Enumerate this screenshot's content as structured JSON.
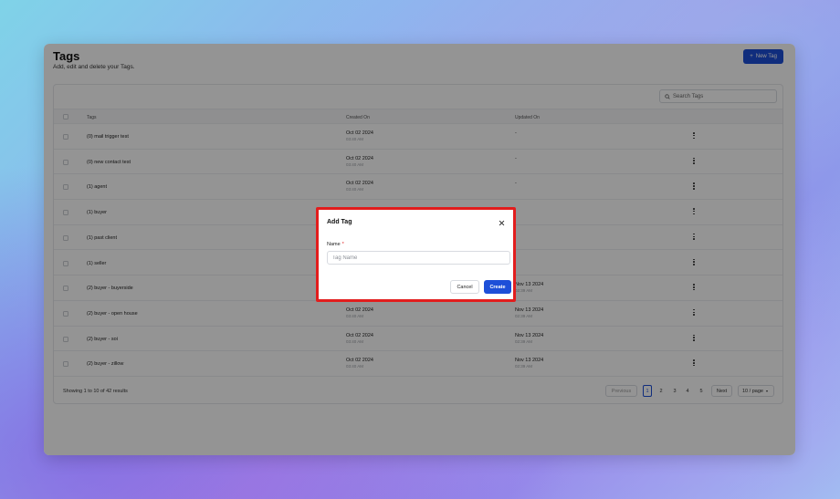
{
  "page": {
    "title": "Tags",
    "subtitle": "Add, edit and delete your Tags.",
    "new_tag_label": "New Tag"
  },
  "search": {
    "placeholder": "Search Tags"
  },
  "table": {
    "columns": [
      "Tags",
      "Created On",
      "Updated On"
    ],
    "rows": [
      {
        "name": "(0) mail trigger test",
        "created_date": "Oct 02 2024",
        "created_time": "03:40 AM",
        "updated_date": "-",
        "updated_time": ""
      },
      {
        "name": "(0) new contact test",
        "created_date": "Oct 02 2024",
        "created_time": "03:40 AM",
        "updated_date": "-",
        "updated_time": ""
      },
      {
        "name": "(1) agent",
        "created_date": "Oct 02 2024",
        "created_time": "03:40 AM",
        "updated_date": "-",
        "updated_time": ""
      },
      {
        "name": "(1) buyer",
        "created_date": "",
        "created_time": "",
        "updated_date": "",
        "updated_time": ""
      },
      {
        "name": "(1) past client",
        "created_date": "",
        "created_time": "",
        "updated_date": "",
        "updated_time": ""
      },
      {
        "name": "(1) seller",
        "created_date": "",
        "created_time": "",
        "updated_date": "",
        "updated_time": ""
      },
      {
        "name": "(2) buyer - buyerside",
        "created_date": "",
        "created_time": "",
        "updated_date": "Nov 13 2024",
        "updated_time": "02:39 AM"
      },
      {
        "name": "(2) buyer - open house",
        "created_date": "Oct 02 2024",
        "created_time": "03:40 AM",
        "updated_date": "Nov 13 2024",
        "updated_time": "02:39 AM"
      },
      {
        "name": "(2) buyer - soi",
        "created_date": "Oct 02 2024",
        "created_time": "03:40 AM",
        "updated_date": "Nov 13 2024",
        "updated_time": "02:39 AM"
      },
      {
        "name": "(2) buyer - zillow",
        "created_date": "Oct 02 2024",
        "created_time": "03:40 AM",
        "updated_date": "Nov 13 2024",
        "updated_time": "02:39 AM"
      }
    ]
  },
  "pagination": {
    "summary": "Showing 1 to 10 of 42 results",
    "previous": "Previous",
    "pages": [
      "1",
      "2",
      "3",
      "4",
      "5"
    ],
    "next": "Next",
    "page_size": "10 / page"
  },
  "dialog": {
    "title": "Add Tag",
    "name_label": "Name",
    "required_mark": "*",
    "name_placeholder": "Tag Name",
    "cancel_label": "Cancel",
    "create_label": "Create"
  },
  "colors": {
    "primary": "#1d4fd8",
    "highlight_border": "#e21d1d"
  }
}
